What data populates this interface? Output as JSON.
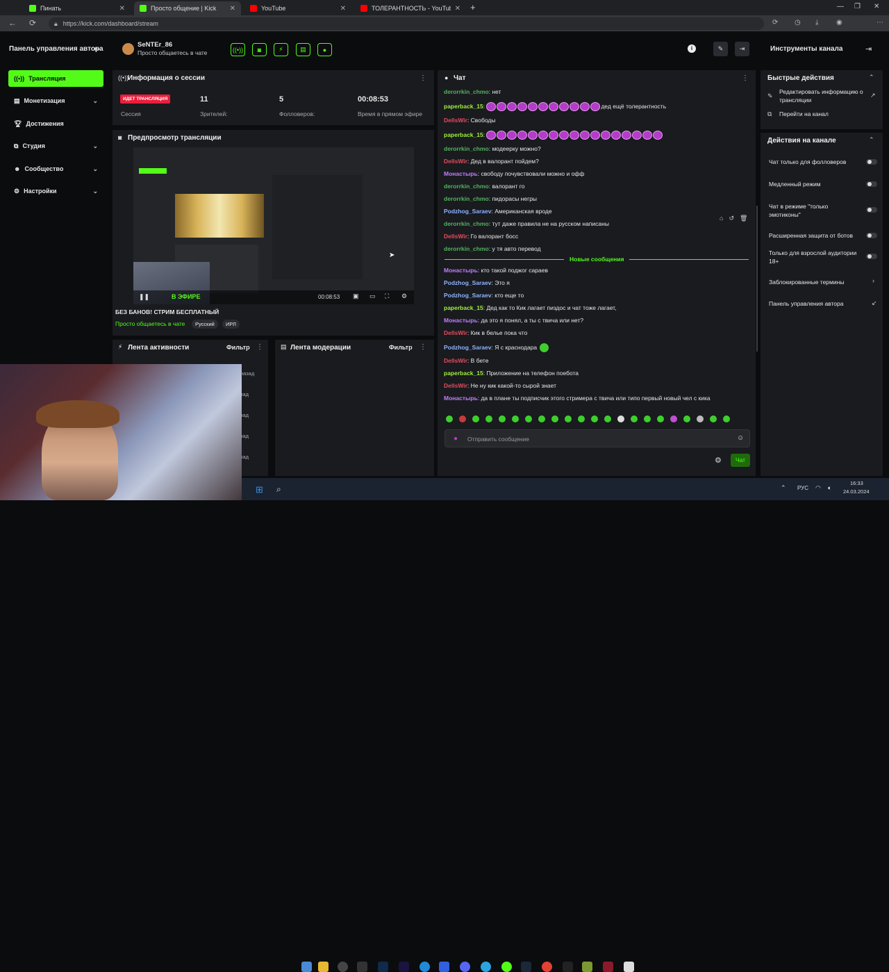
{
  "browser": {
    "tabs": [
      {
        "title": "Пинать",
        "icon_color": "#53fc18"
      },
      {
        "title": "Просто общение | Kick",
        "icon_color": "#53fc18"
      },
      {
        "title": "YouTube",
        "icon_color": "#ff0000"
      },
      {
        "title": "ТОЛЕРАНТНОСТЬ - YouTube",
        "icon_color": "#ff0000"
      }
    ],
    "new_tab": "+",
    "url": "https://kick.com/dashboard/stream"
  },
  "header": {
    "dashboard_title": "Панель управления автора",
    "username": "SeNTEr_86",
    "category": "Просто общаетесь в чате",
    "channel_tools_title": "Инструменты канала"
  },
  "sidebar": {
    "items": [
      {
        "label": "Трансляция",
        "icon": "broadcast-icon"
      },
      {
        "label": "Монетизация",
        "icon": "money-icon"
      },
      {
        "label": "Достижения",
        "icon": "trophy-icon"
      },
      {
        "label": "Студия",
        "icon": "studio-icon"
      },
      {
        "label": "Сообщество",
        "icon": "community-icon"
      },
      {
        "label": "Настройки",
        "icon": "gear-icon"
      }
    ]
  },
  "session": {
    "title": "Информация о сессии",
    "live_badge": "ИДЕТ ТРАНСЛЯЦИЯ",
    "live_label": "Сессия",
    "viewers": "11",
    "viewers_label": "Зрителей:",
    "followers": "5",
    "followers_label": "Фолловеров:",
    "time": "00:08:53",
    "time_label": "Время в прямом эфире"
  },
  "preview": {
    "title": "Предпросмотр трансляции",
    "video_time": "00:08:53",
    "live_overlay": "В ЭФИРЕ",
    "stream_title": "БЕЗ БАНОВ! СТРИМ БЕСПЛАТНЫЙ",
    "category": "Просто общаетесь в чате",
    "tags": [
      "Русский",
      "ИРЛ"
    ]
  },
  "activity": {
    "title": "Лента активности",
    "filter": "Фильтр"
  },
  "moderation": {
    "title": "Лента модерации",
    "filter": "Фильтр"
  },
  "webcam_fragments": [
    "назад",
    "зад",
    "зад",
    "зад",
    "зад",
    "зад"
  ],
  "chat": {
    "title": "Чат",
    "new_messages": "Новые сообщения",
    "input_placeholder": "Отправить сообщение",
    "send_button": "Чат",
    "messages_before": [
      {
        "user": "derorrkin_chmo",
        "color": "#53b35c",
        "text": "нет"
      },
      {
        "user": "paperback_15",
        "color": "#a0f03c",
        "text": "дед ещё толерантность",
        "emotes": 11
      },
      {
        "user": "DellsWir",
        "color": "#e64b5d",
        "text": "Свободы"
      },
      {
        "user": "paperback_15",
        "color": "#a0f03c",
        "text": "",
        "emotes": 17
      },
      {
        "user": "derorrkin_chmo",
        "color": "#53b35c",
        "text": "модеерку можно?"
      },
      {
        "user": "DellsWir",
        "color": "#e64b5d",
        "text": "Дед в валорант пойдем?"
      },
      {
        "user": "Монастырь",
        "color": "#c07dff",
        "text": "свободу почувствовали можно и офф"
      },
      {
        "user": "derorrkin_chmo",
        "color": "#53b35c",
        "text": "валорант го"
      },
      {
        "user": "derorrkin_chmo",
        "color": "#53b35c",
        "text": "пидорасы негры"
      },
      {
        "user": "Podzhog_Saraev",
        "color": "#8fb3ff",
        "text": "Американская вроде"
      },
      {
        "user": "derorrkin_chmo",
        "color": "#53b35c",
        "text": "тут даже правила не на русском написаны"
      },
      {
        "user": "DellsWir",
        "color": "#e64b5d",
        "text": "Го валорант босс"
      },
      {
        "user": "derorrkin_chmo",
        "color": "#53b35c",
        "text": "у тя авто перевод"
      }
    ],
    "messages_after": [
      {
        "user": "Монастырь",
        "color": "#c07dff",
        "text": "кто такой поджог сараев"
      },
      {
        "user": "Podzhog_Saraev",
        "color": "#8fb3ff",
        "text": "Это я"
      },
      {
        "user": "Podzhog_Saraev",
        "color": "#8fb3ff",
        "text": "кто еще то"
      },
      {
        "user": "paperback_15",
        "color": "#a0f03c",
        "text": "Дед как то Кик лагает пиздос и чат тоже лагает,"
      },
      {
        "user": "Монастырь",
        "color": "#c07dff",
        "text": "да это я понял, а ты с твича или нет?"
      },
      {
        "user": "DellsWir",
        "color": "#e64b5d",
        "text": "Кик в белье пока что"
      },
      {
        "user": "Podzhog_Saraev",
        "color": "#8fb3ff",
        "text": "Я с краснодара",
        "green_emote": true
      },
      {
        "user": "DellsWir",
        "color": "#e64b5d",
        "text": "В бете"
      },
      {
        "user": "paperback_15",
        "color": "#a0f03c",
        "text": "Приложение на телефон поебота"
      },
      {
        "user": "DellsWir",
        "color": "#e64b5d",
        "text": "Не ну кик какой-то сырой знает"
      },
      {
        "user": "Монастырь",
        "color": "#c07dff",
        "text": "да в плане ты подписчик этого стримера с твича или типо первый новый чел с кика"
      }
    ]
  },
  "quick_actions": {
    "title": "Быстрые действия",
    "edit_info": "Редактировать информацию о трансляции",
    "go_channel": "Перейти на канал"
  },
  "channel_actions": {
    "title": "Действия на канале",
    "toggles": [
      "Чат только для фолловеров",
      "Медленный режим",
      "Чат в режиме \"только эмотиконы\"",
      "Расширенная защита от ботов",
      "Только для взрослой аудитории 18+"
    ],
    "blocked_terms": "Заблокированные термины",
    "author_dashboard": "Панель управления автора"
  },
  "taskbar": {
    "lang": "РУС",
    "time": "16:33",
    "date": "24.03.2024"
  },
  "colors": {
    "accent": "#53fc18",
    "panel": "#191b1f",
    "bg": "#0b0c0e"
  }
}
